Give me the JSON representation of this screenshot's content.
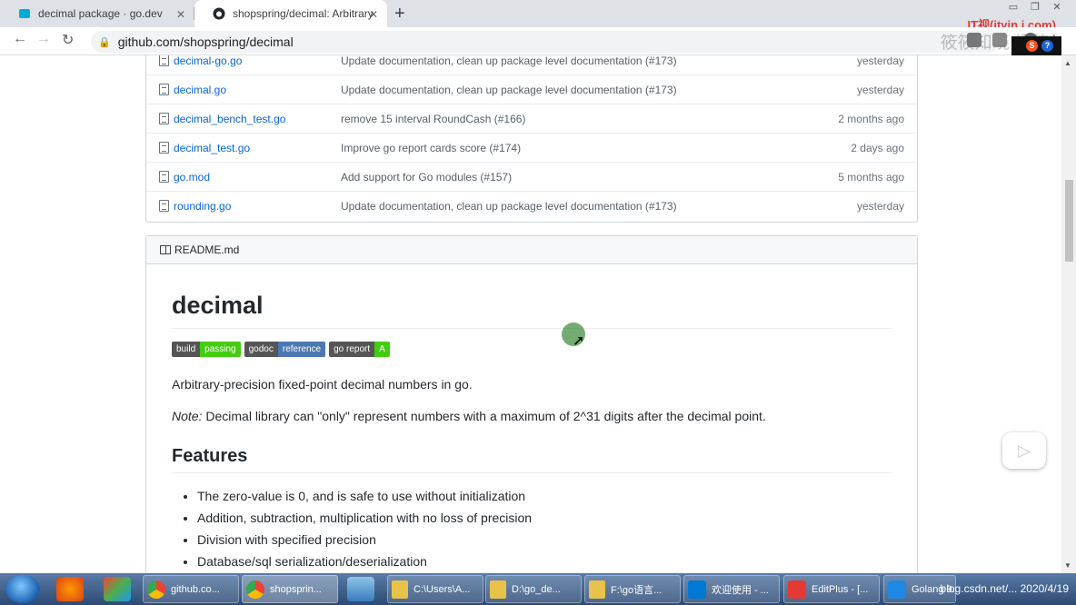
{
  "browser": {
    "tabs": [
      {
        "title": "decimal package · go.dev",
        "active": false
      },
      {
        "title": "shopspring/decimal: Arbitrary",
        "active": true
      }
    ],
    "address": "github.com/shopspring/decimal",
    "brand_logo": "IT视(ityin j.com)",
    "watermark": "筱筱知晓 投稿"
  },
  "files": [
    {
      "name": "decimal-go.go",
      "message": "Update documentation, clean up package level documentation (#173)",
      "age": "yesterday"
    },
    {
      "name": "decimal.go",
      "message": "Update documentation, clean up package level documentation (#173)",
      "age": "yesterday"
    },
    {
      "name": "decimal_bench_test.go",
      "message": "remove 15 interval RoundCash (#166)",
      "age": "2 months ago"
    },
    {
      "name": "decimal_test.go",
      "message": "Improve go report cards score (#174)",
      "age": "2 days ago"
    },
    {
      "name": "go.mod",
      "message": "Add support for Go modules (#157)",
      "age": "5 months ago"
    },
    {
      "name": "rounding.go",
      "message": "Update documentation, clean up package level documentation (#173)",
      "age": "yesterday"
    }
  ],
  "readme": {
    "header": "README.md",
    "title": "decimal",
    "badges": [
      {
        "left": "build",
        "right": "passing"
      },
      {
        "left": "godoc",
        "right": "reference"
      },
      {
        "left": "go report",
        "right": "A"
      }
    ],
    "intro": "Arbitrary-precision fixed-point decimal numbers in go.",
    "note_label": "Note:",
    "note_text": " Decimal library can \"only\" represent numbers with a maximum of 2^31 digits after the decimal point.",
    "features_title": "Features",
    "features": [
      "The zero-value is 0, and is safe to use without initialization",
      "Addition, subtraction, multiplication with no loss of precision",
      "Division with specified precision",
      "Database/sql serialization/deserialization"
    ]
  },
  "taskbar": {
    "tasks": [
      {
        "label": "github.co..."
      },
      {
        "label": "shopsprin..."
      },
      {
        "label": "C:\\Users\\A..."
      },
      {
        "label": "D:\\go_de..."
      },
      {
        "label": "F:\\go语言..."
      },
      {
        "label": "欢迎使用 - ..."
      },
      {
        "label": "EditPlus - [..."
      },
      {
        "label": "Golang 9..."
      }
    ],
    "tray_text": "blog.csdn.net/... 2020/4/19"
  }
}
